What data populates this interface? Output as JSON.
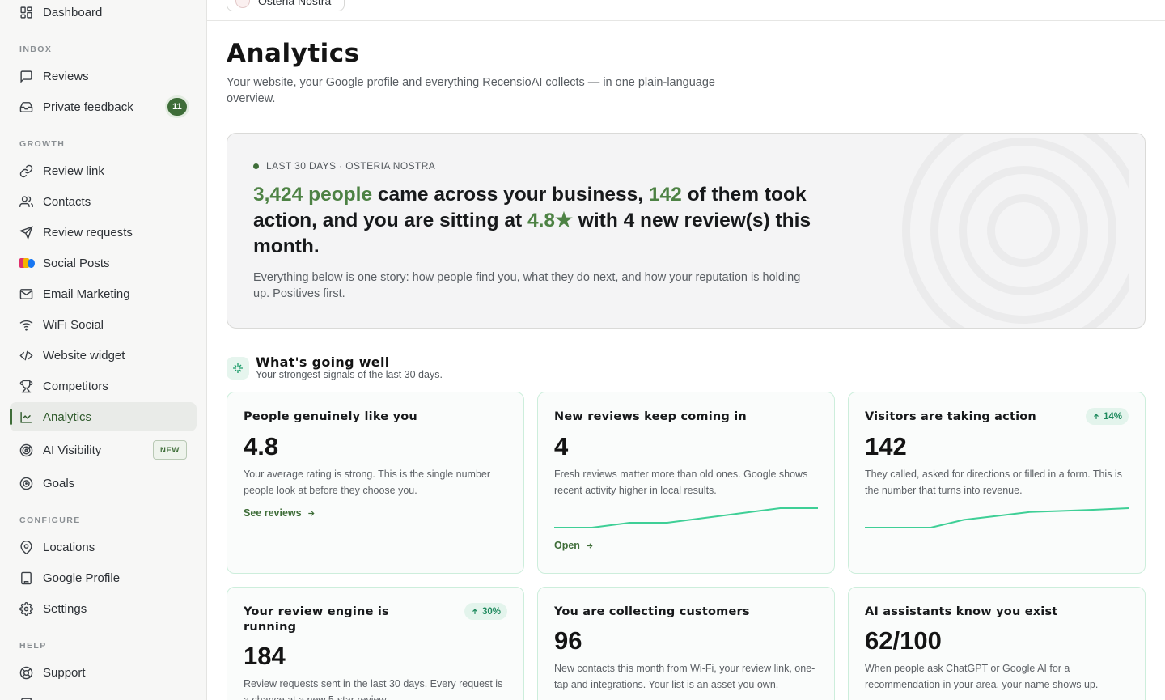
{
  "sidebar": {
    "items": [
      {
        "label": "Dashboard",
        "icon": "dashboard-icon"
      },
      {
        "label": "Reviews",
        "icon": "chat-bubble-icon"
      },
      {
        "label": "Private feedback",
        "icon": "inbox-icon",
        "badge": "11"
      },
      {
        "label": "Review link",
        "icon": "link-icon"
      },
      {
        "label": "Contacts",
        "icon": "users-icon"
      },
      {
        "label": "Review requests",
        "icon": "send-icon"
      },
      {
        "label": "Social Posts",
        "icon": "social-icons"
      },
      {
        "label": "Email Marketing",
        "icon": "mail-icon"
      },
      {
        "label": "WiFi Social",
        "icon": "wifi-icon"
      },
      {
        "label": "Website widget",
        "icon": "code-icon"
      },
      {
        "label": "Competitors",
        "icon": "trophy-icon"
      },
      {
        "label": "Analytics",
        "icon": "line-chart-icon",
        "active": true
      },
      {
        "label": "AI Visibility",
        "icon": "radar-icon",
        "badge": "NEW"
      },
      {
        "label": "Goals",
        "icon": "target-icon"
      },
      {
        "label": "Locations",
        "icon": "map-pin-icon"
      },
      {
        "label": "Google Profile",
        "icon": "building-icon"
      },
      {
        "label": "Settings",
        "icon": "gear-icon"
      },
      {
        "label": "Support",
        "icon": "lifebuoy-icon"
      }
    ],
    "sections": {
      "inbox": "INBOX",
      "growth": "GROWTH",
      "configure": "CONFIGURE",
      "help": "HELP"
    }
  },
  "header": {
    "location_name": "Osteria Nostra"
  },
  "page": {
    "title": "Analytics",
    "subtitle": "Your website, your Google profile and everything RecensioAI collects — in one plain-language overview."
  },
  "hero": {
    "tag": "LAST 30 DAYS · OSTERIA NOSTRA",
    "headline": {
      "people": "3,424 people",
      "part1": " came across your business, ",
      "actions": "142",
      "part2": " of them took action, and you are sitting at ",
      "rating": "4.8★",
      "part3": " with 4 new review(s) this month."
    },
    "body": "Everything below is one story: how people find you, what they do next, and how your reputation is holding up. Positives first."
  },
  "going_well": {
    "title": "What's going well",
    "subtitle": "Your strongest signals of the last 30 days."
  },
  "cards": [
    {
      "title": "People genuinely like you",
      "value": "4.8",
      "desc": "Your average rating is strong. This is the single number people look at before they choose you.",
      "link": "See reviews"
    },
    {
      "title": "New reviews keep coming in",
      "value": "4",
      "desc": "Fresh reviews matter more than old ones. Google shows recent activity higher in local results.",
      "link": "Open",
      "spark": [
        0,
        0,
        1,
        1,
        2,
        3,
        4,
        4
      ]
    },
    {
      "title": "Visitors are taking action",
      "value": "142",
      "desc": "They called, asked for directions or filled in a form. This is the number that turns into revenue.",
      "badge": "14%",
      "spark": [
        0,
        0,
        0,
        2,
        3,
        4,
        4.3,
        4.6,
        5
      ]
    },
    {
      "title": "Your review engine is running",
      "value": "184",
      "desc": "Review requests sent in the last 30 days. Every request is a chance at a new 5-star review.",
      "badge": "30%"
    },
    {
      "title": "You are collecting customers",
      "value": "96",
      "desc": "New contacts this month from Wi-Fi, your review link, one-tap and integrations. Your list is an asset you own."
    },
    {
      "title": "AI assistants know you exist",
      "value": "62/100",
      "desc": "When people ask ChatGPT or Google AI for a recommendation in your area, your name shows up."
    }
  ],
  "colors": {
    "accent": "#3e6d38",
    "highlight": "#4d8244",
    "sparkline": "#3ecf96",
    "badge_bg": "#e3f4ec"
  }
}
